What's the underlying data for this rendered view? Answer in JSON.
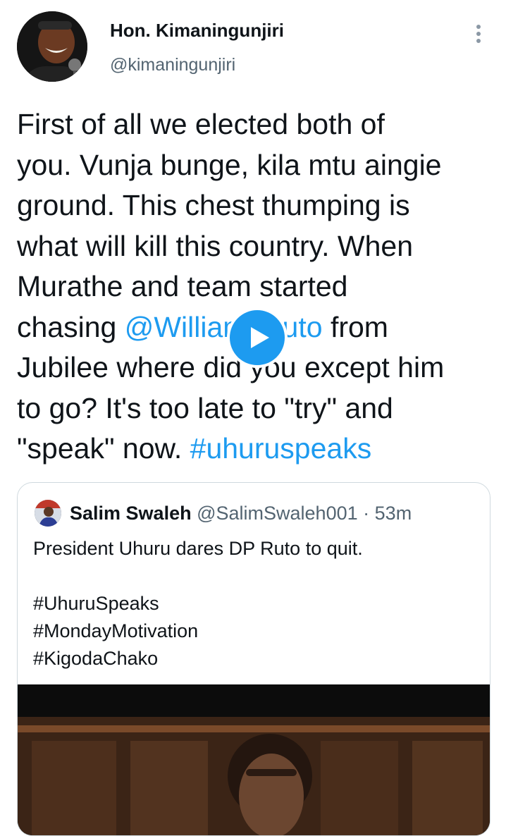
{
  "author": {
    "name": "Hon. Kimaningunjiri",
    "handle": "@kimaningunjiri"
  },
  "icons": {
    "more": "more-vertical-icon",
    "play": "play-icon"
  },
  "tweet": {
    "lines": [
      {
        "text": "First of all we elected both of"
      },
      {
        "text": "you. Vunja bunge, kila mtu aingie"
      },
      {
        "text": "ground. This chest thumping is"
      },
      {
        "text": "what will kill this country. When"
      },
      {
        "text": "Murathe and team started"
      },
      {
        "pre": "chasing ",
        "mention": "@WilliamsRuto",
        "post": " from"
      },
      {
        "text": "Jubilee where did you except him"
      },
      {
        "text": "to go? It's too late to \"try\" and"
      },
      {
        "pre": "\"speak\" now. ",
        "hashtag": "#uhuruspeaks"
      }
    ]
  },
  "quote": {
    "name": "Salim Swaleh",
    "handle": "@SalimSwaleh001",
    "separator": "·",
    "time": "53m",
    "lines": [
      "President Uhuru dares DP Ruto to quit.",
      "",
      "#UhuruSpeaks",
      "#MondayMotivation",
      "#KigodaChako"
    ]
  },
  "colors": {
    "link": "#1d9bf0",
    "secondary_text": "#536471",
    "border": "#cfd9de"
  }
}
